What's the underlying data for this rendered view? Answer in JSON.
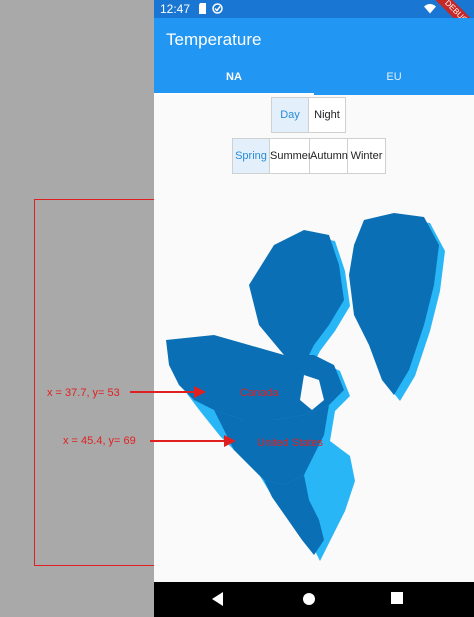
{
  "status": {
    "time": "12:47"
  },
  "app_bar": {
    "title": "Temperature"
  },
  "tabs": [
    {
      "label": "NA",
      "selected": true
    },
    {
      "label": "EU",
      "selected": false
    }
  ],
  "time_toggle": [
    {
      "label": "Day",
      "selected": true
    },
    {
      "label": "Night",
      "selected": false
    }
  ],
  "season_toggle": [
    {
      "label": "Spring",
      "selected": true
    },
    {
      "label": "Summer",
      "selected": false
    },
    {
      "label": "Autumn",
      "selected": false
    },
    {
      "label": "Winter",
      "selected": false
    }
  ],
  "debug_ribbon": "DEBUG",
  "map": {
    "labels": [
      {
        "country": "Canada",
        "tooltip": "x = 37.7, y= 53"
      },
      {
        "country": "United States",
        "tooltip": "x = 45.4, y= 69"
      }
    ]
  },
  "colors": {
    "primary": "#2196f3",
    "map_main": "#0a6fb5",
    "map_shadow": "#29b6f6",
    "annotation": "#e02020"
  },
  "nav": {
    "icons": [
      "back-icon",
      "home-icon",
      "recents-icon"
    ]
  }
}
